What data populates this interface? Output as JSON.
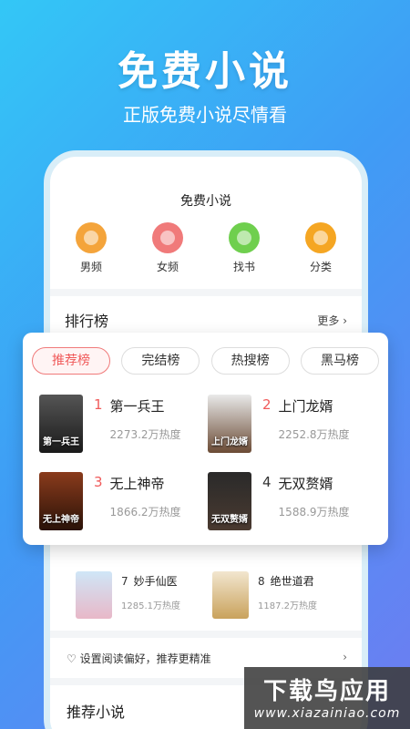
{
  "hero": {
    "title": "免费小说",
    "subtitle": "正版免费小说尽情看"
  },
  "app": {
    "title": "免费小说",
    "nav": [
      {
        "label": "男频",
        "icon": "male-channel-icon"
      },
      {
        "label": "女频",
        "icon": "female-channel-icon"
      },
      {
        "label": "找书",
        "icon": "find-book-icon"
      },
      {
        "label": "分类",
        "icon": "category-icon"
      }
    ],
    "ranking": {
      "title": "排行榜",
      "more": "更多 ›",
      "tabs": [
        "推荐榜",
        "完结榜",
        "热搜榜",
        "黑马榜"
      ],
      "active_tab": "推荐榜",
      "books": [
        {
          "num": "1",
          "name": "第一兵王",
          "heat": "2273.2万热度",
          "cover_text": "第一兵王"
        },
        {
          "num": "2",
          "name": "上门龙婿",
          "heat": "2252.8万热度",
          "cover_text": "上门龙婿"
        },
        {
          "num": "3",
          "name": "无上神帝",
          "heat": "1866.2万热度",
          "cover_text": "无上神帝"
        },
        {
          "num": "4",
          "name": "无双赘婿",
          "heat": "1588.9万热度",
          "cover_text": "无双赘婿"
        }
      ],
      "more_books": [
        {
          "num": "7",
          "name": "妙手仙医",
          "heat": "1285.1万热度"
        },
        {
          "num": "8",
          "name": "绝世道君",
          "heat": "1187.2万热度"
        }
      ]
    },
    "preference": {
      "text": "♡ 设置阅读偏好，推荐更精准",
      "chevron": "›"
    },
    "recommend": {
      "title": "推荐小说"
    }
  },
  "watermark": {
    "cn": "下载鸟应用",
    "en": "www.xiazainiao.com"
  },
  "colors": {
    "accent_red": "#f05a5a",
    "background_gradient_start": "#33c7f6",
    "background_gradient_end": "#6e7cf2"
  }
}
